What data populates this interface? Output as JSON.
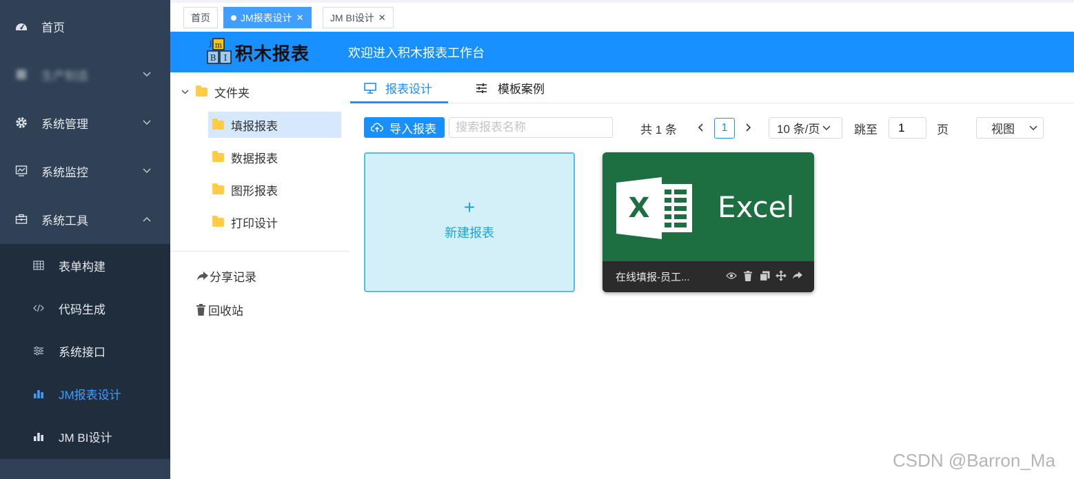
{
  "nav": {
    "home": "首页",
    "blurred_item": "生产制造",
    "system_admin": "系统管理",
    "system_monitor": "系统监控",
    "system_tools": "系统工具",
    "sub_items": [
      "表单构建",
      "代码生成",
      "系统接口",
      "JM报表设计",
      "JM BI设计"
    ]
  },
  "tabs": [
    {
      "label": "首页"
    },
    {
      "label": "JM报表设计"
    },
    {
      "label": "JM BI设计"
    }
  ],
  "header": {
    "logo_text": "积木报表",
    "welcome": "欢迎进入积木报表工作台"
  },
  "tree": {
    "root": "文件夹",
    "nodes": [
      "填报报表",
      "数据报表",
      "图形报表",
      "打印设计"
    ],
    "share_records": "分享记录",
    "recycle_bin": "回收站"
  },
  "main": {
    "tabs": [
      "报表设计",
      "模板案例"
    ],
    "import_label": "导入报表",
    "search_placeholder": "搜索报表名称",
    "total": "共 1 条",
    "current_page": "1",
    "page_size": "10 条/页",
    "jump_label": "跳至",
    "jump_value": "1",
    "page_label": "页",
    "view_label": "视图",
    "new_card_plus": "+",
    "new_card_label": "新建报表",
    "report_card": {
      "name": "在线填报-员工...",
      "brand": "Excel",
      "logo_letter": "X"
    }
  },
  "watermark": "CSDN @Barron_Ma",
  "colors": {
    "nav_bg": "#304156",
    "submenu_bg": "#1f2d3d",
    "accent": "#1890ff",
    "excel_green": "#1d6f42"
  }
}
